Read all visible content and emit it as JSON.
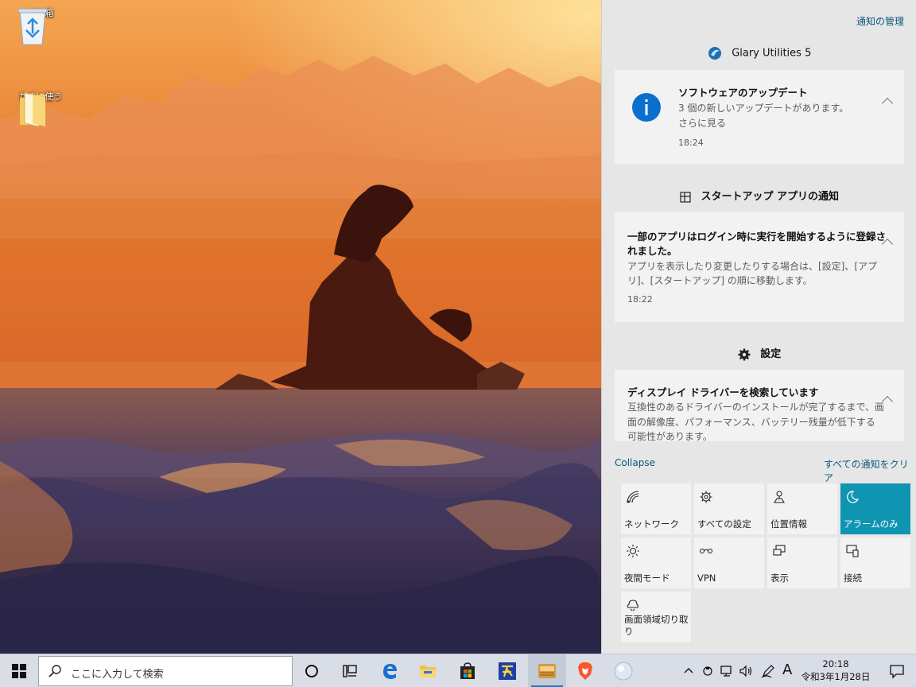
{
  "desktop": {
    "icons": [
      {
        "label": "ごみ箱",
        "icon": "recycle-bin-icon"
      },
      {
        "label": "たまに使う",
        "icon": "folder-icon"
      }
    ]
  },
  "action_center": {
    "manage_link": "通知の管理",
    "groups": [
      {
        "app": "Glary Utilities 5",
        "icon": "glary-utilities-icon",
        "notification": {
          "title": "ソフトウェアのアップデート",
          "body_line1": "3 個の新しいアップデートがあります。",
          "body_line2": "さらに見る",
          "time": "18:24",
          "icon": "info-icon"
        }
      },
      {
        "app": "スタートアップ アプリの通知",
        "icon": "startup-apps-icon",
        "notification": {
          "title_line1": "一部のアプリはログイン時に実行を開始するように登録さ",
          "title_line2": "れました。",
          "body_line1": "アプリを表示したり変更したりする場合は、[設定]、[アプ",
          "body_line2": "リ]、[スタートアップ] の順に移動します。",
          "time": "18:22"
        }
      },
      {
        "app": "設定",
        "icon": "gear-icon",
        "notification": {
          "title": "ディスプレイ ドライバーを検索しています",
          "body_line1": "互換性のあるドライバーのインストールが完了するまで、画",
          "body_line2": "面の解像度、パフォーマンス、バッテリー残量が低下する",
          "body_line3": "可能性があります。"
        }
      }
    ],
    "collapse_label": "Collapse",
    "clear_all_label": "すべての通知をクリア",
    "quick_actions": [
      {
        "label": "ネットワーク",
        "icon": "network-icon",
        "active": false
      },
      {
        "label": "すべての設定",
        "icon": "settings-icon",
        "active": false
      },
      {
        "label": "位置情報",
        "icon": "location-icon",
        "active": false
      },
      {
        "label": "アラームのみ",
        "icon": "moon-icon",
        "active": true
      },
      {
        "label": "夜間モード",
        "icon": "brightness-icon",
        "active": false
      },
      {
        "label": "VPN",
        "icon": "vpn-icon",
        "active": false
      },
      {
        "label": "表示",
        "icon": "project-icon",
        "active": false
      },
      {
        "label": "接続",
        "icon": "connect-icon",
        "active": false
      },
      {
        "label": "画面領域切り取り",
        "icon": "snip-icon",
        "active": false
      }
    ],
    "accent_color": "#0f95b2"
  },
  "taskbar": {
    "search_placeholder": "ここに入力して検索",
    "pinned": [
      {
        "name": "cortana",
        "icon": "cortana-icon"
      },
      {
        "name": "task-view",
        "icon": "task-view-icon"
      },
      {
        "name": "edge",
        "icon": "edge-icon"
      },
      {
        "name": "file-explorer",
        "icon": "file-explorer-icon"
      },
      {
        "name": "store",
        "icon": "store-icon"
      },
      {
        "name": "app-hide",
        "icon": "app-icon"
      },
      {
        "name": "app-active",
        "icon": "app-icon"
      },
      {
        "name": "brave",
        "icon": "brave-icon"
      },
      {
        "name": "app-globe",
        "icon": "app-icon"
      }
    ],
    "tray": {
      "ime_label": "A",
      "time": "20:18",
      "date": "令和3年1月28日"
    }
  }
}
